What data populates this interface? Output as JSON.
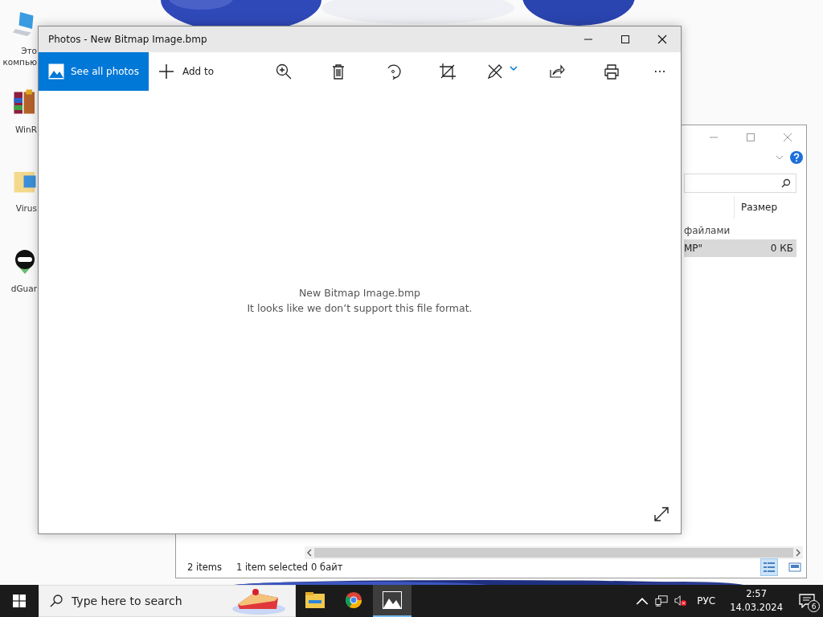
{
  "desktop": {
    "icons": [
      {
        "lines": [
          "Это",
          "компью"
        ]
      },
      {
        "lines": [
          "WinR"
        ]
      },
      {
        "lines": [
          "Virus"
        ]
      },
      {
        "lines": [
          "dGuar"
        ]
      }
    ]
  },
  "explorer": {
    "column_header": "Размер",
    "group_label": "файлами",
    "rows": [
      {
        "name": "МР\"",
        "size": "0 КБ",
        "selected": true
      }
    ],
    "status": {
      "items": "2 items",
      "selected": "1 item selected",
      "size": "0 байт"
    }
  },
  "photos": {
    "title": "Photos - New Bitmap Image.bmp",
    "toolbar": [
      {
        "kind": "primary",
        "label": "See all photos"
      },
      {
        "kind": "add",
        "label": "Add to"
      },
      {
        "kind": "zoom"
      },
      {
        "kind": "delete"
      },
      {
        "kind": "rotate"
      },
      {
        "kind": "crop"
      },
      {
        "kind": "edit"
      },
      {
        "kind": "share"
      },
      {
        "kind": "print"
      },
      {
        "kind": "more",
        "label": "···"
      }
    ],
    "message": {
      "file": "New Bitmap Image.bmp",
      "text": "It looks like we don’t support this file format."
    }
  },
  "taskbar": {
    "search": {
      "placeholder": "Type here to search"
    },
    "apps": [
      {
        "kind": "folder",
        "selected": false
      },
      {
        "kind": "browser",
        "selected": false
      },
      {
        "kind": "photos",
        "selected": true
      }
    ],
    "language": "РУС",
    "time": "2:57",
    "date": "14.03.2024",
    "notifications": "6"
  }
}
